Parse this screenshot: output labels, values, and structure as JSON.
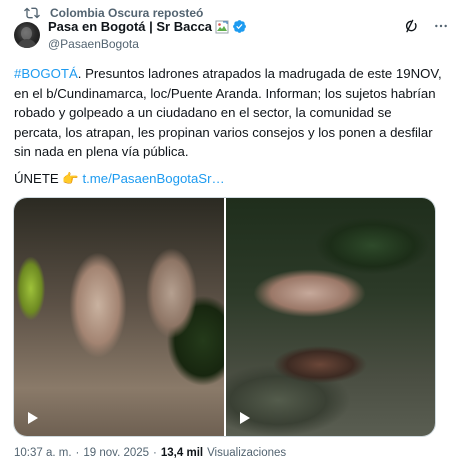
{
  "repost": {
    "text": "Colombia Oscura reposteó"
  },
  "author": {
    "display_name": "Pasa en Bogotá | Sr Bacca",
    "handle": "@PasaenBogota",
    "verified_color": "#1d9bf0"
  },
  "tweet": {
    "hashtag": "#BOGOTÁ",
    "body": ". Presuntos ladrones atrapados la madrugada de este 19NOV, en el b/Cundinamarca, loc/Puente Aranda. Informan; los sujetos habrían robado y golpeado a un ciudadano en el sector, la comunidad se percata, los atrapan, les propinan varios consejos y los ponen a desfilar sin nada en plena vía pública.",
    "join_label": "ÚNETE",
    "join_emoji": "👉",
    "link_text": "t.me/PasaenBogotaSr…"
  },
  "media": {
    "videos": [
      {
        "icon": "play-icon"
      },
      {
        "icon": "play-icon"
      }
    ]
  },
  "meta": {
    "time": "10:37 a. m.",
    "separator": "·",
    "date": "19 nov. 2025",
    "views_count": "13,4 mil",
    "views_label": "Visualizaciones"
  },
  "colors": {
    "accent": "#1d9bf0",
    "text": "#0f1419",
    "muted": "#536471"
  }
}
